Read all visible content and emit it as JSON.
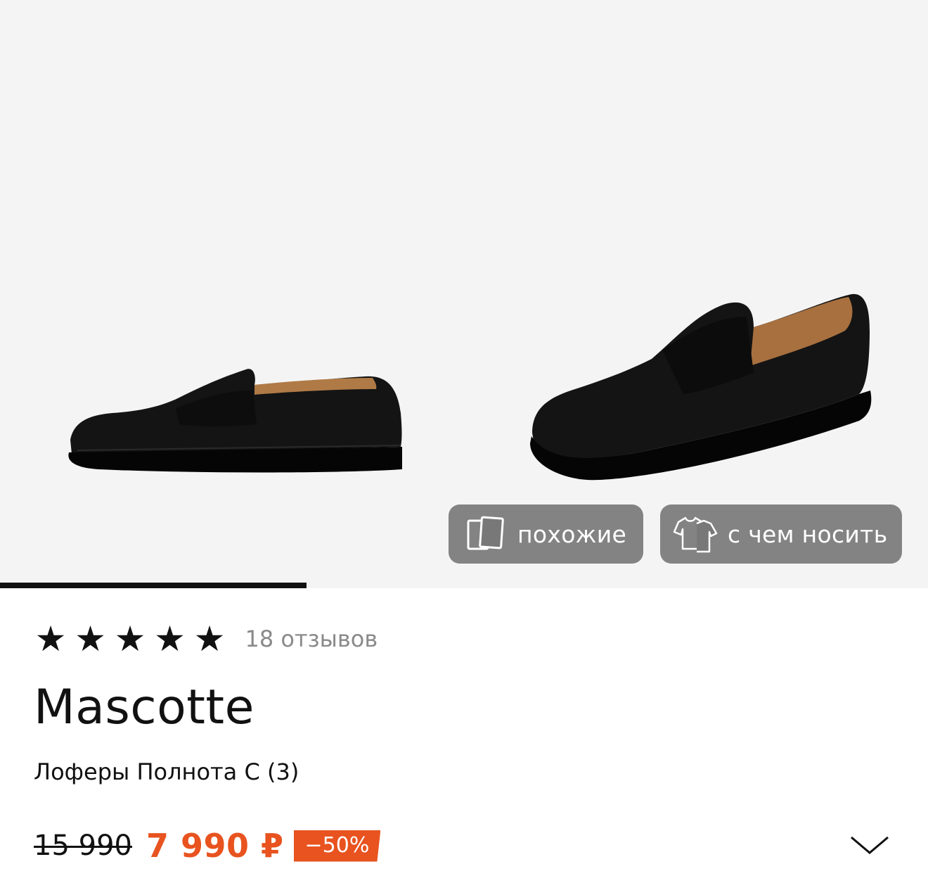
{
  "gallery": {
    "image_alt_left": "",
    "image_alt_right": "",
    "progress": 0.33,
    "chips": {
      "similar": "похожие",
      "wear": "с чем носить"
    }
  },
  "product": {
    "rating_stars": 5,
    "reviews": "18 отзывов",
    "brand": "Mascotte",
    "title": "Лоферы Полнота C (3)",
    "old_price": "15 990",
    "price": "7 990 ₽",
    "discount": "−50%"
  },
  "colors": {
    "accent": "#e8531f",
    "chip_bg": "#787878",
    "text": "#111111",
    "muted": "#8a8a8a"
  },
  "icons": {
    "similar": "cards-icon",
    "wear": "outfit-icon",
    "star": "star-icon",
    "expand": "chevron-down-icon"
  }
}
